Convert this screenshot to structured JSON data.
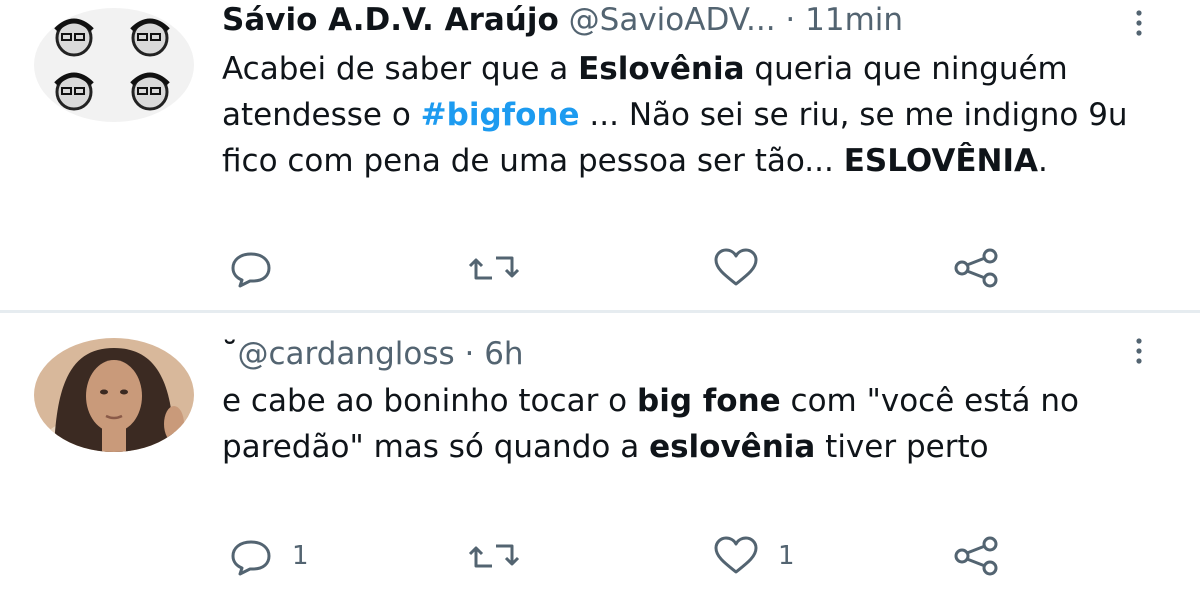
{
  "tweets": [
    {
      "display_name": "Sávio A.D.V. Araújo",
      "handle": "@SavioADV...",
      "separator": "·",
      "time": "11min",
      "body": [
        {
          "text": "Acabei de saber que a ",
          "style": "normal"
        },
        {
          "text": "Eslovênia",
          "style": "bold"
        },
        {
          "text": " queria que ninguém atendesse o ",
          "style": "normal"
        },
        {
          "text": "#bigfone",
          "style": "hashtag"
        },
        {
          "text": " ... Não sei se riu, se me indigno 9u fico com pena de uma pessoa ser tão... ",
          "style": "normal"
        },
        {
          "text": "ESLOVÊNIA",
          "style": "bold"
        },
        {
          "text": ".",
          "style": "normal"
        }
      ],
      "actions": {
        "reply_count": "",
        "retweet_count": "",
        "like_count": ""
      }
    },
    {
      "display_name": "˘",
      "handle": "@cardangloss",
      "separator": "·",
      "time": "6h",
      "body": [
        {
          "text": "e cabe ao boninho tocar o ",
          "style": "normal"
        },
        {
          "text": "big fone",
          "style": "bold"
        },
        {
          "text": " com \"você está no paredão\" mas só quando a ",
          "style": "normal"
        },
        {
          "text": "eslovênia",
          "style": "bold"
        },
        {
          "text": " tiver perto",
          "style": "normal"
        }
      ],
      "actions": {
        "reply_count": "1",
        "retweet_count": "",
        "like_count": "1"
      }
    }
  ],
  "icons": {
    "more": "more-vertical-icon",
    "reply": "reply-icon",
    "retweet": "retweet-icon",
    "like": "heart-icon",
    "share": "share-icon"
  },
  "colors": {
    "text": "#0f1419",
    "muted": "#536471",
    "hashtag": "#1d9bf0",
    "divider": "#e6ecf0"
  }
}
